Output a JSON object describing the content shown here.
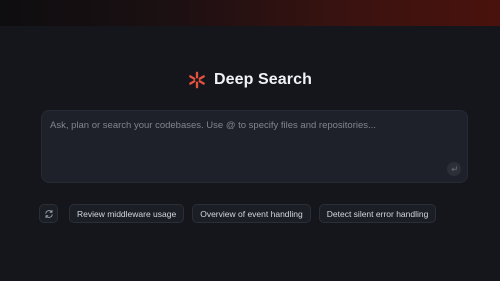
{
  "header": {
    "logo_icon": "asterisk-spark-icon",
    "title": "Deep Search",
    "accent_color": "#e5533d"
  },
  "search": {
    "placeholder": "Ask, plan or search your codebases. Use @ to specify files and repositories...",
    "value": "",
    "send_icon": "enter-return-icon"
  },
  "suggestions": {
    "refresh_icon": "refresh-icon",
    "items": [
      {
        "label": "Review middleware usage"
      },
      {
        "label": "Overview of event handling"
      },
      {
        "label": "Detect silent error handling"
      }
    ]
  },
  "theme": {
    "background": "#14161c",
    "surface": "#1e2129",
    "top_band_gradient_end": "#4a120c"
  }
}
